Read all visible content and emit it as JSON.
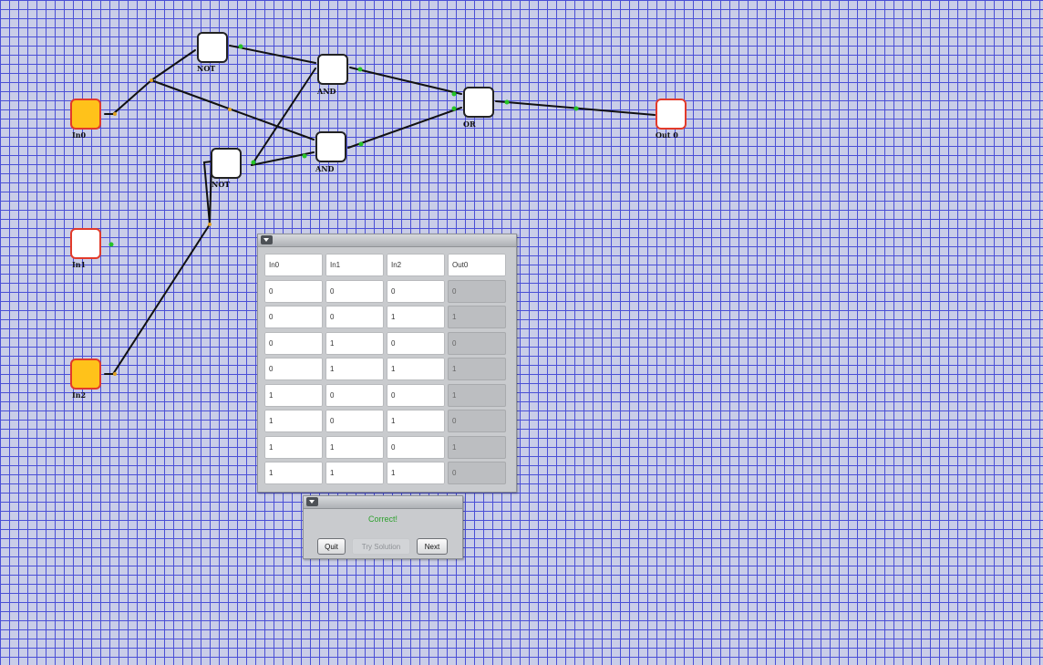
{
  "nodes": {
    "in0": {
      "label": "In0",
      "on": true
    },
    "in1": {
      "label": "In1",
      "on": false
    },
    "in2": {
      "label": "In2",
      "on": true
    },
    "not_top": {
      "label": "NOT"
    },
    "not_mid": {
      "label": "NOT"
    },
    "and_top": {
      "label": "AND"
    },
    "and_bottom": {
      "label": "AND"
    },
    "or": {
      "label": "OR"
    },
    "out0": {
      "label": "Out 0"
    }
  },
  "truth_table": {
    "headers": [
      "In0",
      "In1",
      "In2",
      "Out0"
    ],
    "rows": [
      [
        "0",
        "0",
        "0",
        "0"
      ],
      [
        "0",
        "0",
        "1",
        "1"
      ],
      [
        "0",
        "1",
        "0",
        "0"
      ],
      [
        "0",
        "1",
        "1",
        "1"
      ],
      [
        "1",
        "0",
        "0",
        "1"
      ],
      [
        "1",
        "0",
        "1",
        "0"
      ],
      [
        "1",
        "1",
        "0",
        "1"
      ],
      [
        "1",
        "1",
        "1",
        "0"
      ]
    ]
  },
  "result_panel": {
    "status": "Correct!",
    "quit_label": "Quit",
    "try_label": "Try Solution",
    "next_label": "Next"
  },
  "colors": {
    "grid_line": "#4a4fd6",
    "background": "#c9cde8",
    "input_on": "#ffc21a",
    "io_border": "#e23a2a",
    "status_text": "#2ea12e",
    "pin_green": "#26c426"
  }
}
